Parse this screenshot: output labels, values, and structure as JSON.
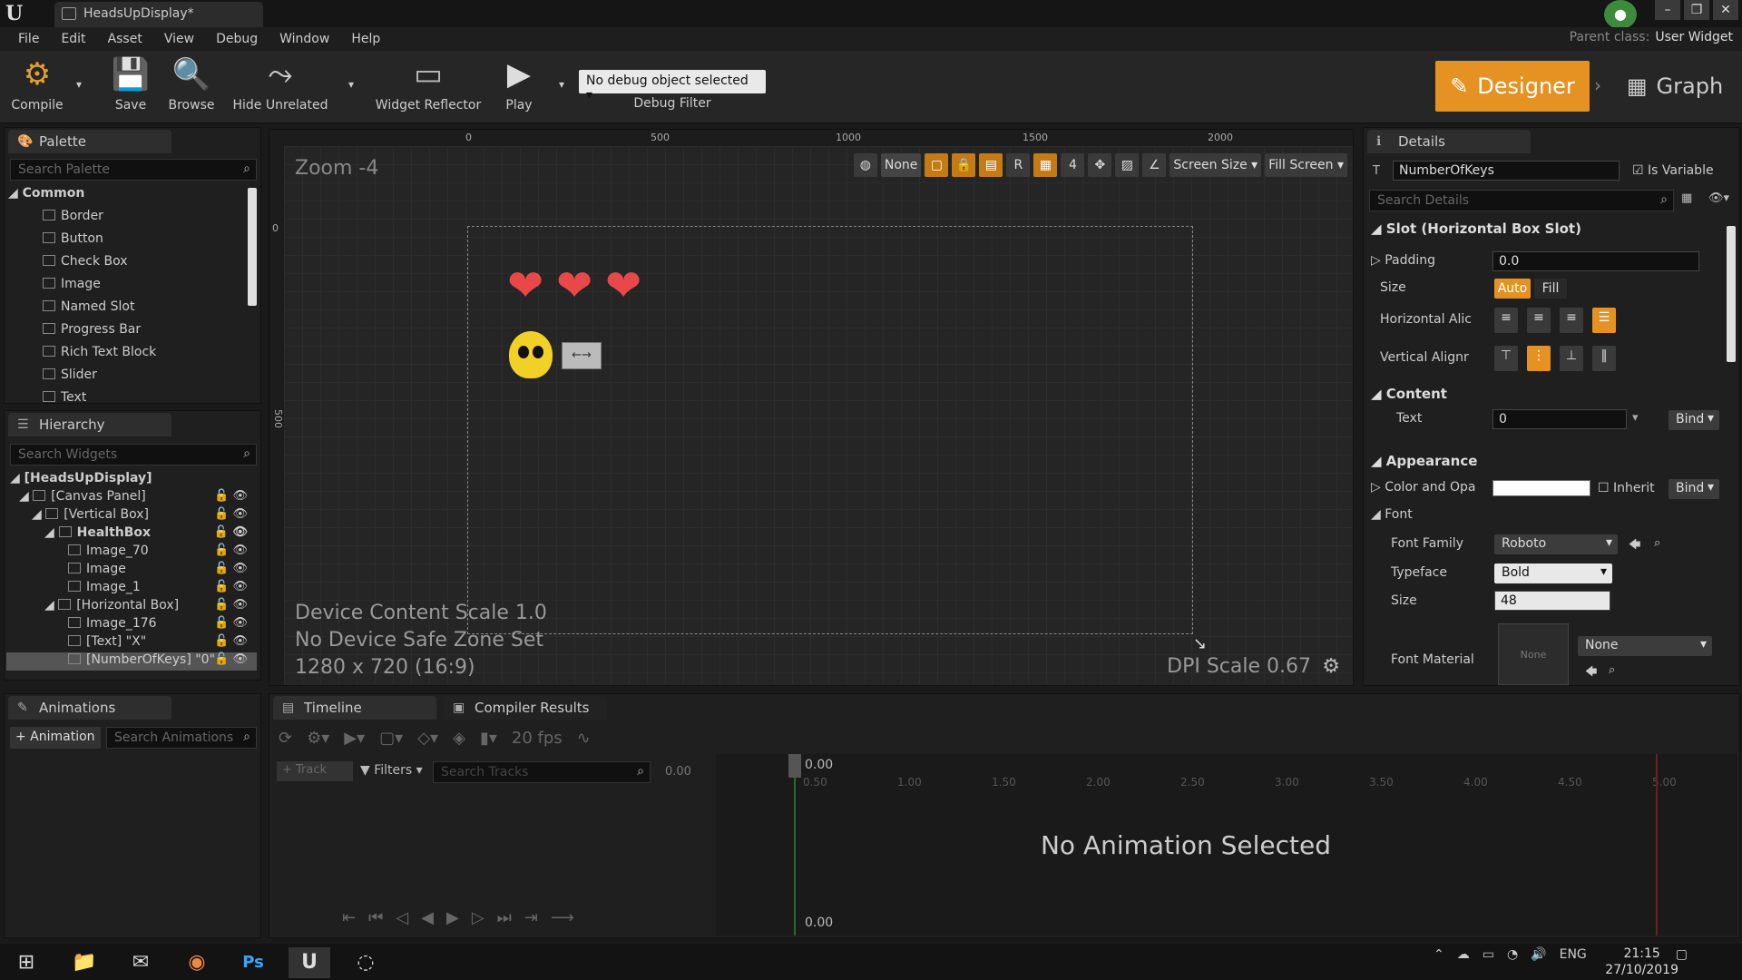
{
  "window": {
    "tab_title": "HeadsUpDisplay*",
    "parent_class_label": "Parent class:",
    "parent_class_value": "User Widget",
    "controls": [
      "–",
      "❐",
      "✕"
    ]
  },
  "menu": [
    "File",
    "Edit",
    "Asset",
    "View",
    "Debug",
    "Window",
    "Help"
  ],
  "toolbar": {
    "compile": "Compile",
    "save": "Save",
    "browse": "Browse",
    "hide_unrelated": "Hide Unrelated",
    "widget_reflector": "Widget Reflector",
    "play": "Play",
    "debug_selector": "No debug object selected",
    "debug_filter": "Debug Filter",
    "designer": "Designer",
    "graph": "Graph",
    "accent": "#e69223"
  },
  "palette": {
    "tab": "Palette",
    "search_placeholder": "Search Palette",
    "category": "Common",
    "items": [
      "Border",
      "Button",
      "Check Box",
      "Image",
      "Named Slot",
      "Progress Bar",
      "Rich Text Block",
      "Slider",
      "Text"
    ]
  },
  "hierarchy": {
    "tab": "Hierarchy",
    "search_placeholder": "Search Widgets",
    "root": "[HeadsUpDisplay]",
    "rows": [
      {
        "label": "[Canvas Panel]"
      },
      {
        "label": "[Vertical Box]"
      },
      {
        "label": "HealthBox"
      },
      {
        "label": "Image_70"
      },
      {
        "label": "Image"
      },
      {
        "label": "Image_1"
      },
      {
        "label": "[Horizontal Box]"
      },
      {
        "label": "Image_176"
      },
      {
        "label": "[Text] \"X\""
      },
      {
        "label": "[NumberOfKeys] \"0\""
      }
    ]
  },
  "viewport": {
    "zoom": "Zoom -4",
    "ruler_x": [
      "0",
      "500",
      "1000",
      "1500",
      "2000"
    ],
    "ruler_y": [
      "0",
      "500"
    ],
    "tool_none": "None",
    "tool_r": "R",
    "tool_4": "4",
    "screen_size": "Screen Size",
    "fill_screen": "Fill Screen",
    "device_scale": "Device Content Scale 1.0",
    "safe_zone": "No Device Safe Zone Set",
    "resolution": "1280 x 720 (16:9)",
    "dpi": "DPI Scale 0.67",
    "heart_glyph": "❤",
    "key_widget": "←→"
  },
  "details": {
    "tab": "Details",
    "widget_name": "NumberOfKeys",
    "is_variable": "Is Variable",
    "search_placeholder": "Search Details",
    "slot_section": "Slot (Horizontal Box Slot)",
    "padding_label": "Padding",
    "padding_value": "0.0",
    "size_label": "Size",
    "size_auto": "Auto",
    "size_fill": "Fill",
    "halign_label": "Horizontal Alic",
    "valign_label": "Vertical Alignr",
    "content_section": "Content",
    "text_label": "Text",
    "text_value": "0",
    "bind": "Bind",
    "appearance_section": "Appearance",
    "color_label": "Color and Opa",
    "inherit": "Inherit",
    "font_label": "Font",
    "font_family_label": "Font Family",
    "font_family_value": "Roboto",
    "typeface_label": "Typeface",
    "typeface_value": "Bold",
    "font_size_label": "Size",
    "font_size_value": "48",
    "font_material_label": "Font Material",
    "font_material_thumb": "None",
    "font_material_value": "None"
  },
  "animations": {
    "tab": "Animations",
    "add_button": "+ Animation",
    "search_placeholder": "Search Animations"
  },
  "timeline": {
    "tab": "Timeline",
    "compiler_tab": "Compiler Results",
    "fps": "20 fps",
    "track_button": "+ Track",
    "filters": "Filters",
    "search_placeholder": "Search Tracks",
    "time_value": "0.00",
    "ruler": [
      "0.00",
      "0.50",
      "1.00",
      "1.50",
      "2.00",
      "2.50",
      "3.00",
      "3.50",
      "4.00",
      "4.50",
      "5.00"
    ],
    "empty_message": "No Animation Selected"
  },
  "taskbar": {
    "language": "ENG",
    "time": "21:15",
    "date": "27/10/2019",
    "apps": [
      "⊞",
      "📁",
      "✉",
      "◉",
      "Ps",
      "U",
      "◌"
    ]
  }
}
